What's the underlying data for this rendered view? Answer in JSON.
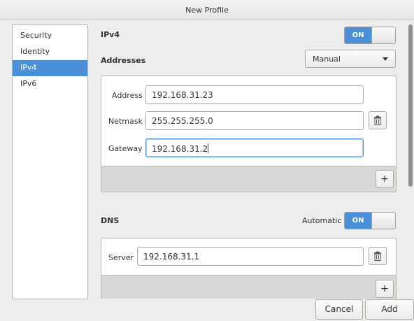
{
  "window": {
    "title": "New Profile"
  },
  "sidebar": {
    "items": [
      {
        "label": "Security"
      },
      {
        "label": "Identity"
      },
      {
        "label": "IPv4"
      },
      {
        "label": "IPv6"
      }
    ]
  },
  "ipv4": {
    "heading": "IPv4",
    "toggle_label": "ON",
    "addresses_label": "Addresses",
    "method": "Manual",
    "fields": {
      "address": {
        "label": "Address",
        "value": "192.168.31.23"
      },
      "netmask": {
        "label": "Netmask",
        "value": "255.255.255.0"
      },
      "gateway": {
        "label": "Gateway",
        "value": "192.168.31.2"
      }
    },
    "add_symbol": "+"
  },
  "dns": {
    "heading": "DNS",
    "automatic_label": "Automatic",
    "toggle_label": "ON",
    "server": {
      "label": "Server",
      "value": "192.168.31.1"
    },
    "add_symbol": "+"
  },
  "actions": {
    "cancel": "Cancel",
    "add": "Add"
  }
}
